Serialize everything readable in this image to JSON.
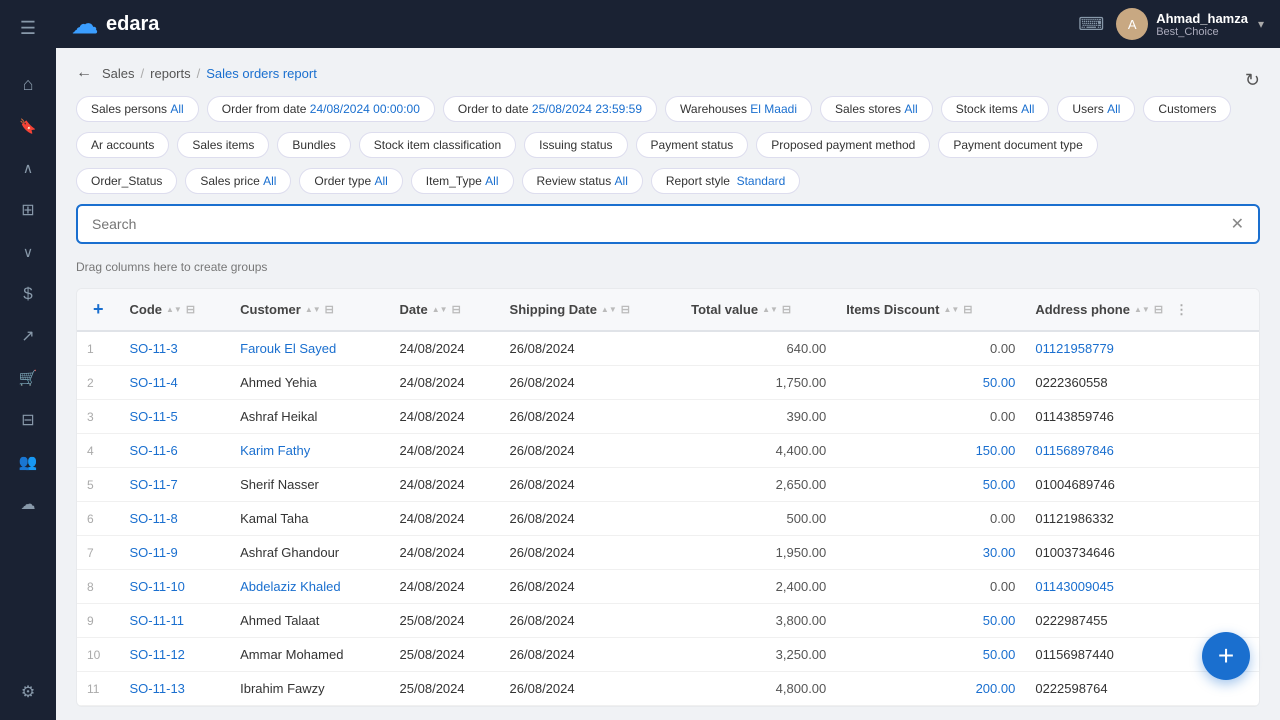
{
  "app": {
    "name": "edara",
    "logo_icon": "☁"
  },
  "topbar": {
    "username": "Ahmad_hamza",
    "company": "Best_Choice",
    "avatar_initials": "A"
  },
  "sidebar": {
    "icons": [
      {
        "name": "menu-icon",
        "symbol": "☰"
      },
      {
        "name": "home-icon",
        "symbol": "⌂"
      },
      {
        "name": "bookmark-icon",
        "symbol": "🔖"
      },
      {
        "name": "chevron-up-icon",
        "symbol": "∧"
      },
      {
        "name": "grid-icon",
        "symbol": "⊞"
      },
      {
        "name": "chevron-down-icon2",
        "symbol": "∨"
      },
      {
        "name": "dollar-icon",
        "symbol": "$"
      },
      {
        "name": "chart-icon",
        "symbol": "↗"
      },
      {
        "name": "cart-icon",
        "symbol": "🛒"
      },
      {
        "name": "table-icon",
        "symbol": "⊟"
      },
      {
        "name": "users-icon",
        "symbol": "👥"
      },
      {
        "name": "cloud-icon",
        "symbol": "☁"
      },
      {
        "name": "settings-icon",
        "symbol": "⚙"
      }
    ]
  },
  "breadcrumb": {
    "back_label": "←",
    "items": [
      "Sales",
      "reports",
      "Sales orders report"
    ],
    "current_index": 2
  },
  "filters": [
    {
      "label": "Sales persons",
      "value": "All"
    },
    {
      "label": "Order from date",
      "value": "24/08/2024 00:00:00"
    },
    {
      "label": "Order to date",
      "value": "25/08/2024 23:59:59"
    },
    {
      "label": "Warehouses",
      "value": "El Maadi"
    },
    {
      "label": "Sales stores",
      "value": "All"
    },
    {
      "label": "Stock items",
      "value": "All"
    },
    {
      "label": "Users",
      "value": "All"
    },
    {
      "label": "Customers",
      "value": ""
    },
    {
      "label": "Ar accounts",
      "value": ""
    },
    {
      "label": "Sales items",
      "value": ""
    },
    {
      "label": "Bundles",
      "value": ""
    },
    {
      "label": "Stock item classification",
      "value": ""
    },
    {
      "label": "Issuing status",
      "value": ""
    },
    {
      "label": "Payment status",
      "value": ""
    },
    {
      "label": "Proposed payment method",
      "value": ""
    },
    {
      "label": "Payment document type",
      "value": ""
    },
    {
      "label": "Order_Status",
      "value": ""
    },
    {
      "label": "Sales price",
      "value": "All"
    },
    {
      "label": "Order type",
      "value": "All"
    },
    {
      "label": "Item_Type",
      "value": "All"
    },
    {
      "label": "Review status",
      "value": "All"
    },
    {
      "label": "Report style",
      "value": "Standard"
    }
  ],
  "search": {
    "placeholder": "Search",
    "value": ""
  },
  "drag_zone": "Drag columns here to create groups",
  "table": {
    "columns": [
      {
        "key": "row_num",
        "label": ""
      },
      {
        "key": "code",
        "label": "Code"
      },
      {
        "key": "customer",
        "label": "Customer"
      },
      {
        "key": "date",
        "label": "Date"
      },
      {
        "key": "shipping_date",
        "label": "Shipping Date"
      },
      {
        "key": "total_value",
        "label": "Total value"
      },
      {
        "key": "items_discount",
        "label": "Items Discount"
      },
      {
        "key": "address_phone",
        "label": "Address phone"
      }
    ],
    "rows": [
      {
        "row_num": 1,
        "code": "SO-11-3",
        "customer": "Farouk El Sayed",
        "customer_link": true,
        "date": "24/08/2024",
        "shipping_date": "26/08/2024",
        "total_value": "640.00",
        "items_discount": "0.00",
        "address_phone": "01121958779"
      },
      {
        "row_num": 2,
        "code": "SO-11-4",
        "customer": "Ahmed Yehia",
        "customer_link": false,
        "date": "24/08/2024",
        "shipping_date": "26/08/2024",
        "total_value": "1,750.00",
        "items_discount": "50.00",
        "address_phone": "0222360558"
      },
      {
        "row_num": 3,
        "code": "SO-11-5",
        "customer": "Ashraf Heikal",
        "customer_link": false,
        "date": "24/08/2024",
        "shipping_date": "26/08/2024",
        "total_value": "390.00",
        "items_discount": "0.00",
        "address_phone": "01143859746"
      },
      {
        "row_num": 4,
        "code": "SO-11-6",
        "customer": "Karim Fathy",
        "customer_link": true,
        "date": "24/08/2024",
        "shipping_date": "26/08/2024",
        "total_value": "4,400.00",
        "items_discount": "150.00",
        "address_phone": "01156897846"
      },
      {
        "row_num": 5,
        "code": "SO-11-7",
        "customer": "Sherif Nasser",
        "customer_link": false,
        "date": "24/08/2024",
        "shipping_date": "26/08/2024",
        "total_value": "2,650.00",
        "items_discount": "50.00",
        "address_phone": "01004689746"
      },
      {
        "row_num": 6,
        "code": "SO-11-8",
        "customer": "Kamal Taha",
        "customer_link": false,
        "date": "24/08/2024",
        "shipping_date": "26/08/2024",
        "total_value": "500.00",
        "items_discount": "0.00",
        "address_phone": "01121986332"
      },
      {
        "row_num": 7,
        "code": "SO-11-9",
        "customer": "Ashraf Ghandour",
        "customer_link": false,
        "date": "24/08/2024",
        "shipping_date": "26/08/2024",
        "total_value": "1,950.00",
        "items_discount": "30.00",
        "address_phone": "01003734646"
      },
      {
        "row_num": 8,
        "code": "SO-11-10",
        "customer": "Abdelaziz Khaled",
        "customer_link": true,
        "date": "24/08/2024",
        "shipping_date": "26/08/2024",
        "total_value": "2,400.00",
        "items_discount": "0.00",
        "address_phone": "01143009045"
      },
      {
        "row_num": 9,
        "code": "SO-11-11",
        "customer": "Ahmed Talaat",
        "customer_link": false,
        "date": "25/08/2024",
        "shipping_date": "26/08/2024",
        "total_value": "3,800.00",
        "items_discount": "50.00",
        "address_phone": "0222987455"
      },
      {
        "row_num": 10,
        "code": "SO-11-12",
        "customer": "Ammar Mohamed",
        "customer_link": false,
        "date": "25/08/2024",
        "shipping_date": "26/08/2024",
        "total_value": "3,250.00",
        "items_discount": "50.00",
        "address_phone": "01156987440"
      },
      {
        "row_num": 11,
        "code": "SO-11-13",
        "customer": "Ibrahim Fawzy",
        "customer_link": false,
        "date": "25/08/2024",
        "shipping_date": "26/08/2024",
        "total_value": "4,800.00",
        "items_discount": "200.00",
        "address_phone": "0222598764"
      }
    ]
  },
  "fab": {
    "label": "+"
  }
}
